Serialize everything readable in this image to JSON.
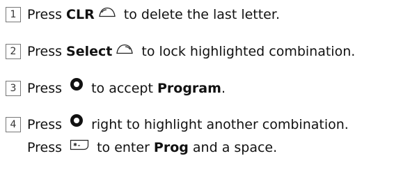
{
  "steps": [
    {
      "number": "1",
      "parts": [
        "Press ",
        "CLR",
        " to delete the last letter."
      ],
      "icon": "clr-softkey-left-icon"
    },
    {
      "number": "2",
      "parts": [
        "Press ",
        "Select",
        " to lock highlighted combination."
      ],
      "icon": "select-softkey-right-icon"
    },
    {
      "number": "3",
      "parts": [
        "Press ",
        " to accept ",
        "Program",
        "."
      ],
      "icon": "nav-key-icon"
    },
    {
      "number": "4",
      "line1": [
        "Press ",
        " right to highlight another combination."
      ],
      "line2": [
        "Press ",
        " to enter ",
        "Prog",
        " and a space."
      ],
      "icons": [
        "nav-key-icon",
        "star-key-icon"
      ]
    }
  ]
}
